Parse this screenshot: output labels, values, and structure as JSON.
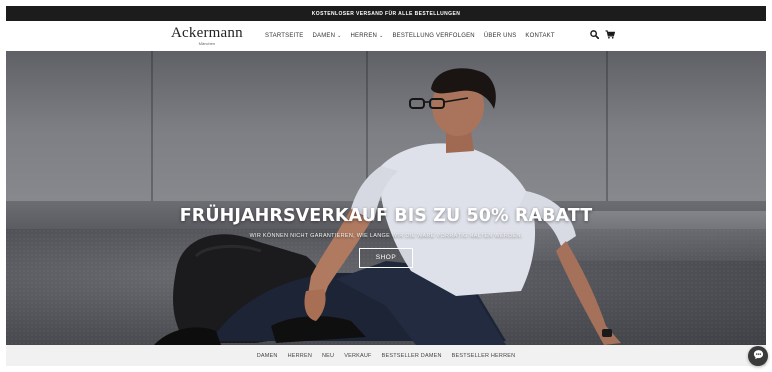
{
  "announcement": {
    "text": "KOSTENLOSER VERSAND FÜR ALLE BESTELLUNGEN"
  },
  "brand": {
    "name": "Ackermann",
    "tagline": "Mänchen"
  },
  "nav": {
    "items": [
      {
        "label": "STARTSEITE",
        "dropdown": false
      },
      {
        "label": "DAMEN",
        "dropdown": true
      },
      {
        "label": "HERREN",
        "dropdown": true
      },
      {
        "label": "BESTELLUNG VERFOLGEN",
        "dropdown": false
      },
      {
        "label": "ÜBER UNS",
        "dropdown": false
      },
      {
        "label": "KONTAKT",
        "dropdown": false
      }
    ]
  },
  "header_icons": [
    "search-icon",
    "cart-icon"
  ],
  "hero": {
    "title": "FRÜHJAHRSVERKAUF BIS ZU 50% RABATT",
    "subtitle": "WIR KÖNNEN NICHT GARANTIEREN, WIE LANGE WIR DIE WARE VORRÄTIG HALTEN WERDEN.",
    "button_label": "SHOP"
  },
  "category_bar": {
    "items": [
      "DAMEN",
      "HERREN",
      "NEU",
      "VERKAUF",
      "BESTSELLER DAMEN",
      "BESTSELLER HERREN"
    ]
  },
  "colors": {
    "announcement_bg": "#1c1c1c",
    "category_bar_bg": "#f1f1f1",
    "chat_button_bg": "#3a3a3a"
  }
}
